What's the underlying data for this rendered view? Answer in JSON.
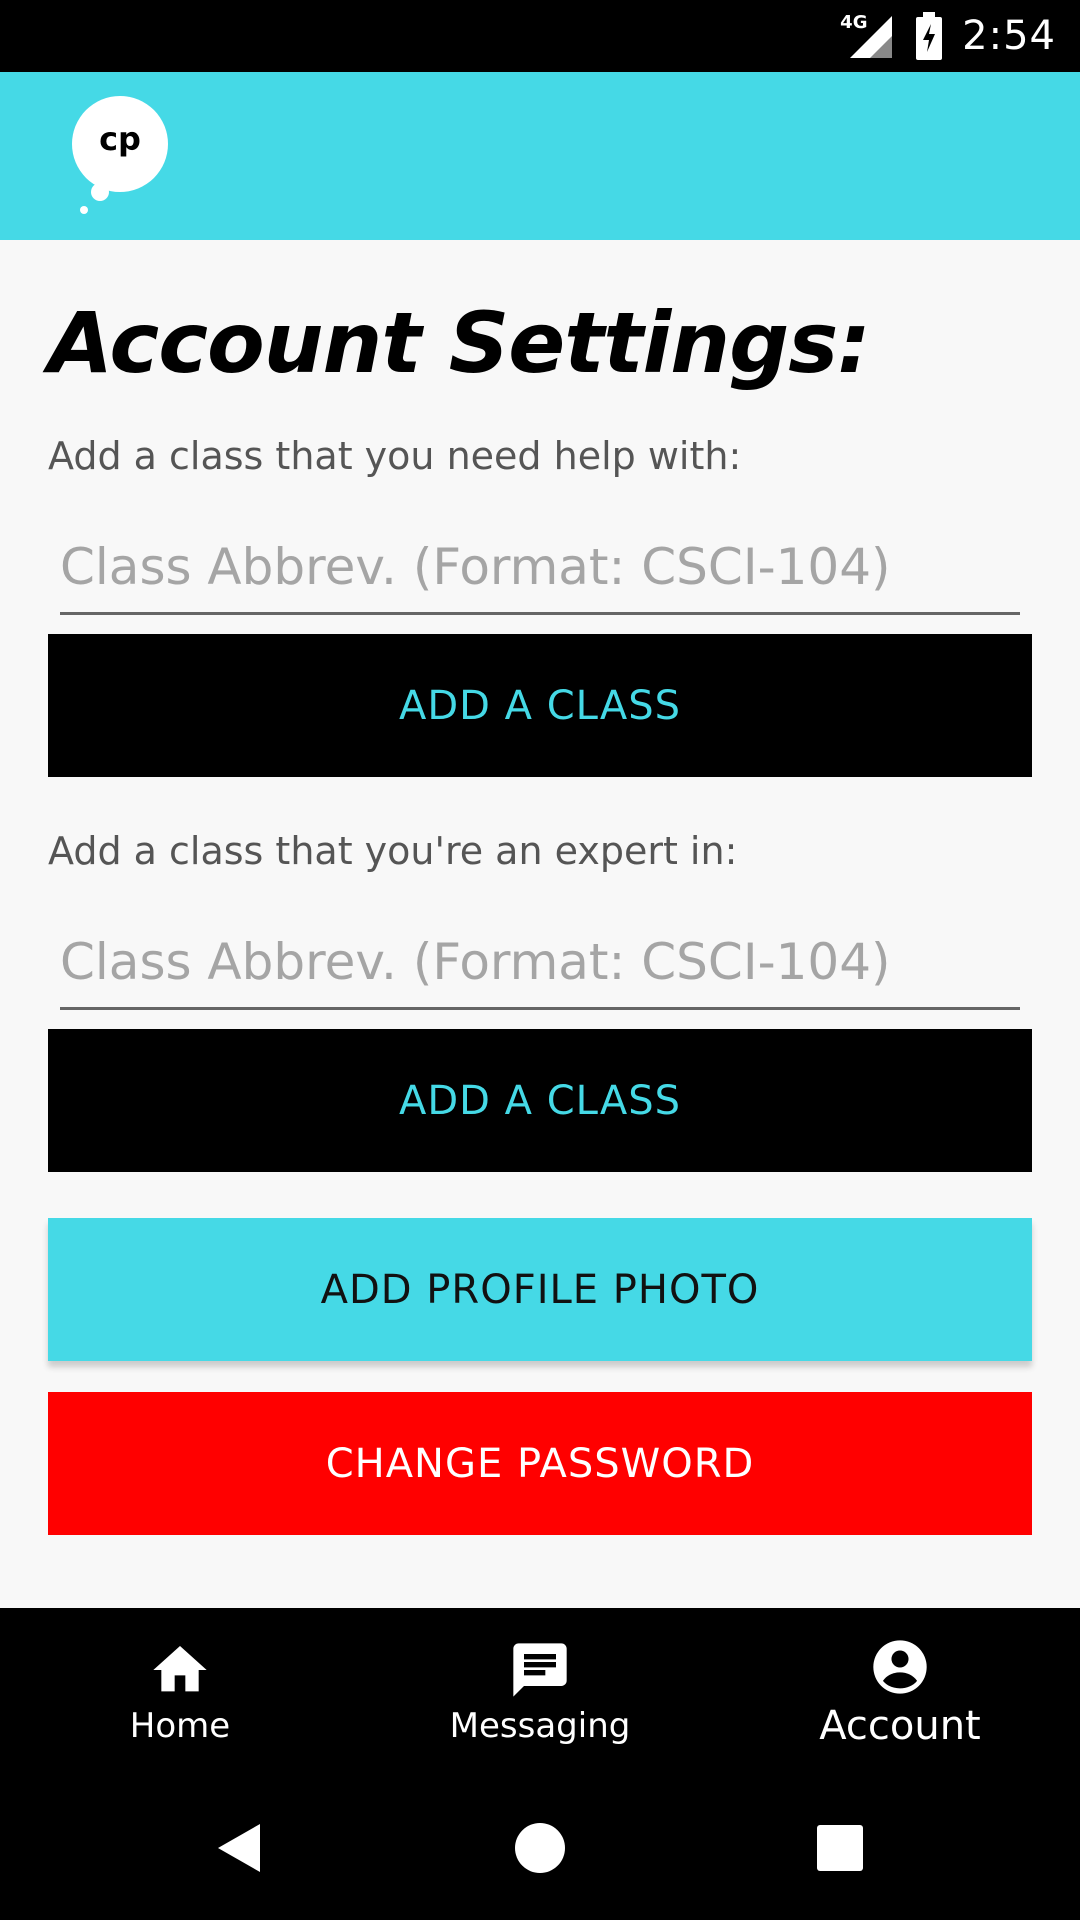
{
  "status_bar": {
    "network": "4G",
    "time": "2:54"
  },
  "app_bar": {
    "logo_text": "cp"
  },
  "page": {
    "title": "Account Settings:",
    "help_section": {
      "label": "Add a class that you need help with:",
      "placeholder": "Class Abbrev. (Format: CSCI-104)",
      "value": "",
      "button_label": "ADD A CLASS"
    },
    "expert_section": {
      "label": "Add a class that you're an expert in:",
      "placeholder": "Class Abbrev. (Format: CSCI-104)",
      "value": "",
      "button_label": "ADD A CLASS"
    },
    "profile_photo_label": "ADD PROFILE PHOTO",
    "change_password_label": "CHANGE PASSWORD"
  },
  "bottom_nav": {
    "items": [
      {
        "label": "Home",
        "icon": "home-icon"
      },
      {
        "label": "Messaging",
        "icon": "message-icon"
      },
      {
        "label": "Account",
        "icon": "account-icon",
        "active": true
      }
    ]
  },
  "colors": {
    "accent": "#45d9e6",
    "danger": "#ff0000",
    "dark": "#000000"
  }
}
